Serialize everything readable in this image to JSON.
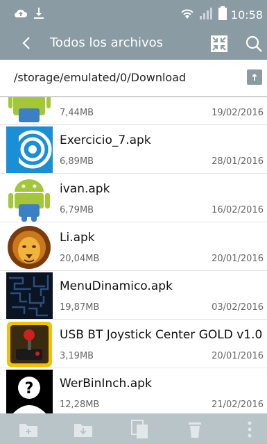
{
  "status": {
    "time": "10:58",
    "icons": [
      "cloud-upload-icon",
      "download-icon",
      "wifi-icon",
      "signal-icon",
      "battery-icon"
    ]
  },
  "appbar": {
    "title": "Todos los archivos",
    "back_icon": "back-arrow-icon",
    "view_icon": "collapse-view-icon",
    "search_icon": "search-icon"
  },
  "path": {
    "text": "/storage/emulated/0/Download",
    "up_icon": "folder-up-icon"
  },
  "files": [
    {
      "name": "",
      "size": "7,44MB",
      "date": "19/02/2016",
      "icon": "android-apk-icon"
    },
    {
      "name": "Exercicio_7.apk",
      "size": "6,89MB",
      "date": "28/01/2016",
      "icon": "concentric-circles-app-icon"
    },
    {
      "name": "ivan.apk",
      "size": "6,79MB",
      "date": "16/02/2016",
      "icon": "android-apk-icon"
    },
    {
      "name": "Li.apk",
      "size": "20,04MB",
      "date": "20/01/2016",
      "icon": "lion-app-icon"
    },
    {
      "name": "MenuDinamico.apk",
      "size": "19,87MB",
      "date": "03/02/2016",
      "icon": "maze-app-icon"
    },
    {
      "name": "USB BT Joystick Center GOLD v1.0",
      "size": "3,19MB",
      "date": "20/01/2016",
      "icon": "joystick-app-icon"
    },
    {
      "name": "WerBinInch.apk",
      "size": "12,28MB",
      "date": "21/02/2016",
      "icon": "unknown-person-icon"
    }
  ],
  "bottombar": {
    "icons": [
      "new-folder-icon",
      "move-to-folder-icon",
      "copy-icon",
      "delete-icon",
      "more-options-icon"
    ]
  },
  "colors": {
    "bar": "#8a9ba4",
    "bottombar": "#b9c4c9",
    "android_green": "#a4c639",
    "android_blue": "#3b7fc4"
  }
}
